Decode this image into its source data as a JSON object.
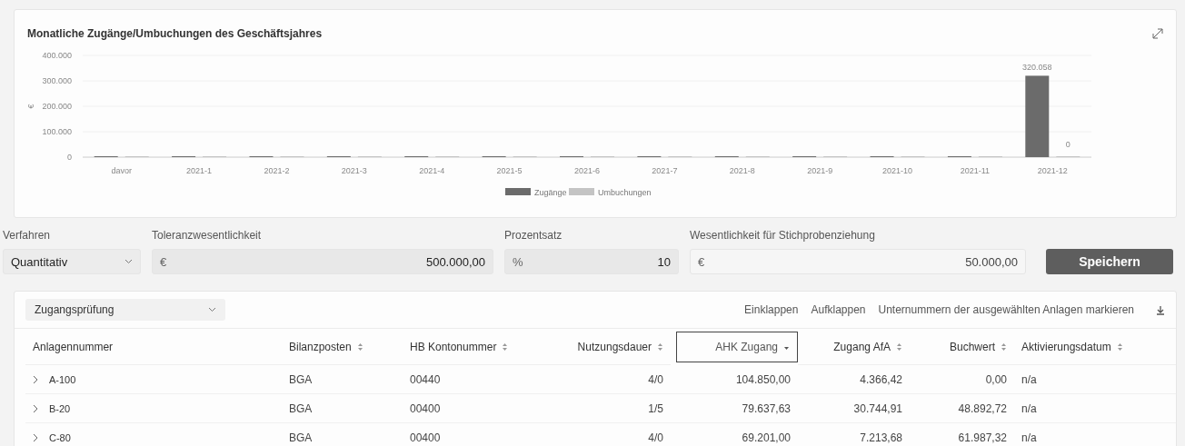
{
  "chart_card": {
    "title": "Monatliche Zugänge/Umbuchungen des Geschäftsjahres",
    "chart_data": {
      "type": "bar",
      "ylabel": "€",
      "categories": [
        "davor",
        "2021-1",
        "2021-2",
        "2021-3",
        "2021-4",
        "2021-5",
        "2021-6",
        "2021-7",
        "2021-8",
        "2021-9",
        "2021-10",
        "2021-11",
        "2021-12"
      ],
      "series": [
        {
          "name": "Zugänge",
          "color": "#6b6b6b",
          "values": [
            0,
            0,
            0,
            0,
            0,
            0,
            0,
            0,
            0,
            0,
            0,
            0,
            320058
          ]
        },
        {
          "name": "Umbuchungen",
          "color": "#c4c4c4",
          "values": [
            0,
            0,
            0,
            0,
            0,
            0,
            0,
            0,
            0,
            0,
            0,
            0,
            0
          ]
        }
      ],
      "ylim": [
        0,
        400000
      ],
      "yticks": [
        {
          "value": 0,
          "label": "0"
        },
        {
          "value": 100000,
          "label": "100.000"
        },
        {
          "value": 200000,
          "label": "200.000"
        },
        {
          "value": 300000,
          "label": "300.000"
        },
        {
          "value": 400000,
          "label": "400.000"
        }
      ],
      "grid": true,
      "legend": "bottom",
      "annotations": [
        {
          "x": "2021-12",
          "y": 320058,
          "text": "320.058"
        },
        {
          "x": "2021-12",
          "y": 0,
          "text": "0"
        }
      ]
    }
  },
  "settings": {
    "fields": [
      {
        "kind": "select",
        "label": "Verfahren",
        "value": "Quantitativ"
      },
      {
        "kind": "amount",
        "label": "Toleranzwesentlichkeit",
        "unit": "€",
        "value": "500.000,00",
        "disabled": true
      },
      {
        "kind": "amount",
        "label": "Prozentsatz",
        "unit": "%",
        "value": "10",
        "disabled": true
      },
      {
        "kind": "amount",
        "label": "Wesentlichkeit für Stichprobenziehung",
        "unit": "€",
        "value": "50.000,00",
        "disabled": false
      }
    ],
    "save_button": "Speichern"
  },
  "table": {
    "view_select": "Zugangsprüfung",
    "actions": [
      "Einklappen",
      "Aufklappen",
      "Unternummern der ausgewählten Anlagen markieren"
    ],
    "columns": [
      {
        "label": "Anlagennummer",
        "kind": "plain",
        "numeric": false
      },
      {
        "label": "Bilanzposten",
        "kind": "sortable",
        "numeric": false
      },
      {
        "label": "HB Kontonummer",
        "kind": "sortable",
        "numeric": false
      },
      {
        "label": "Nutzungsdauer",
        "kind": "sortable",
        "numeric": true
      },
      {
        "label": "AHK Zugang",
        "kind": "sorted",
        "numeric": true
      },
      {
        "label": "Zugang AfA",
        "kind": "sortable",
        "numeric": true
      },
      {
        "label": "Buchwert",
        "kind": "sortable",
        "numeric": true
      },
      {
        "label": "Aktivierungsdatum",
        "kind": "sortable",
        "numeric": false
      }
    ],
    "rows": [
      {
        "expanded": false,
        "cells": [
          "A-100",
          "BGA",
          "00440",
          "4/0",
          "104.850,00",
          "4.366,42",
          "0,00",
          "n/a"
        ]
      },
      {
        "expanded": false,
        "cells": [
          "B-20",
          "BGA",
          "00400",
          "1/5",
          "79.637,63",
          "30.744,91",
          "48.892,72",
          "n/a"
        ]
      },
      {
        "expanded": false,
        "cells": [
          "C-80",
          "BGA",
          "00400",
          "4/0",
          "69.201,00",
          "7.213,68",
          "61.987,32",
          "n/a"
        ]
      }
    ]
  }
}
